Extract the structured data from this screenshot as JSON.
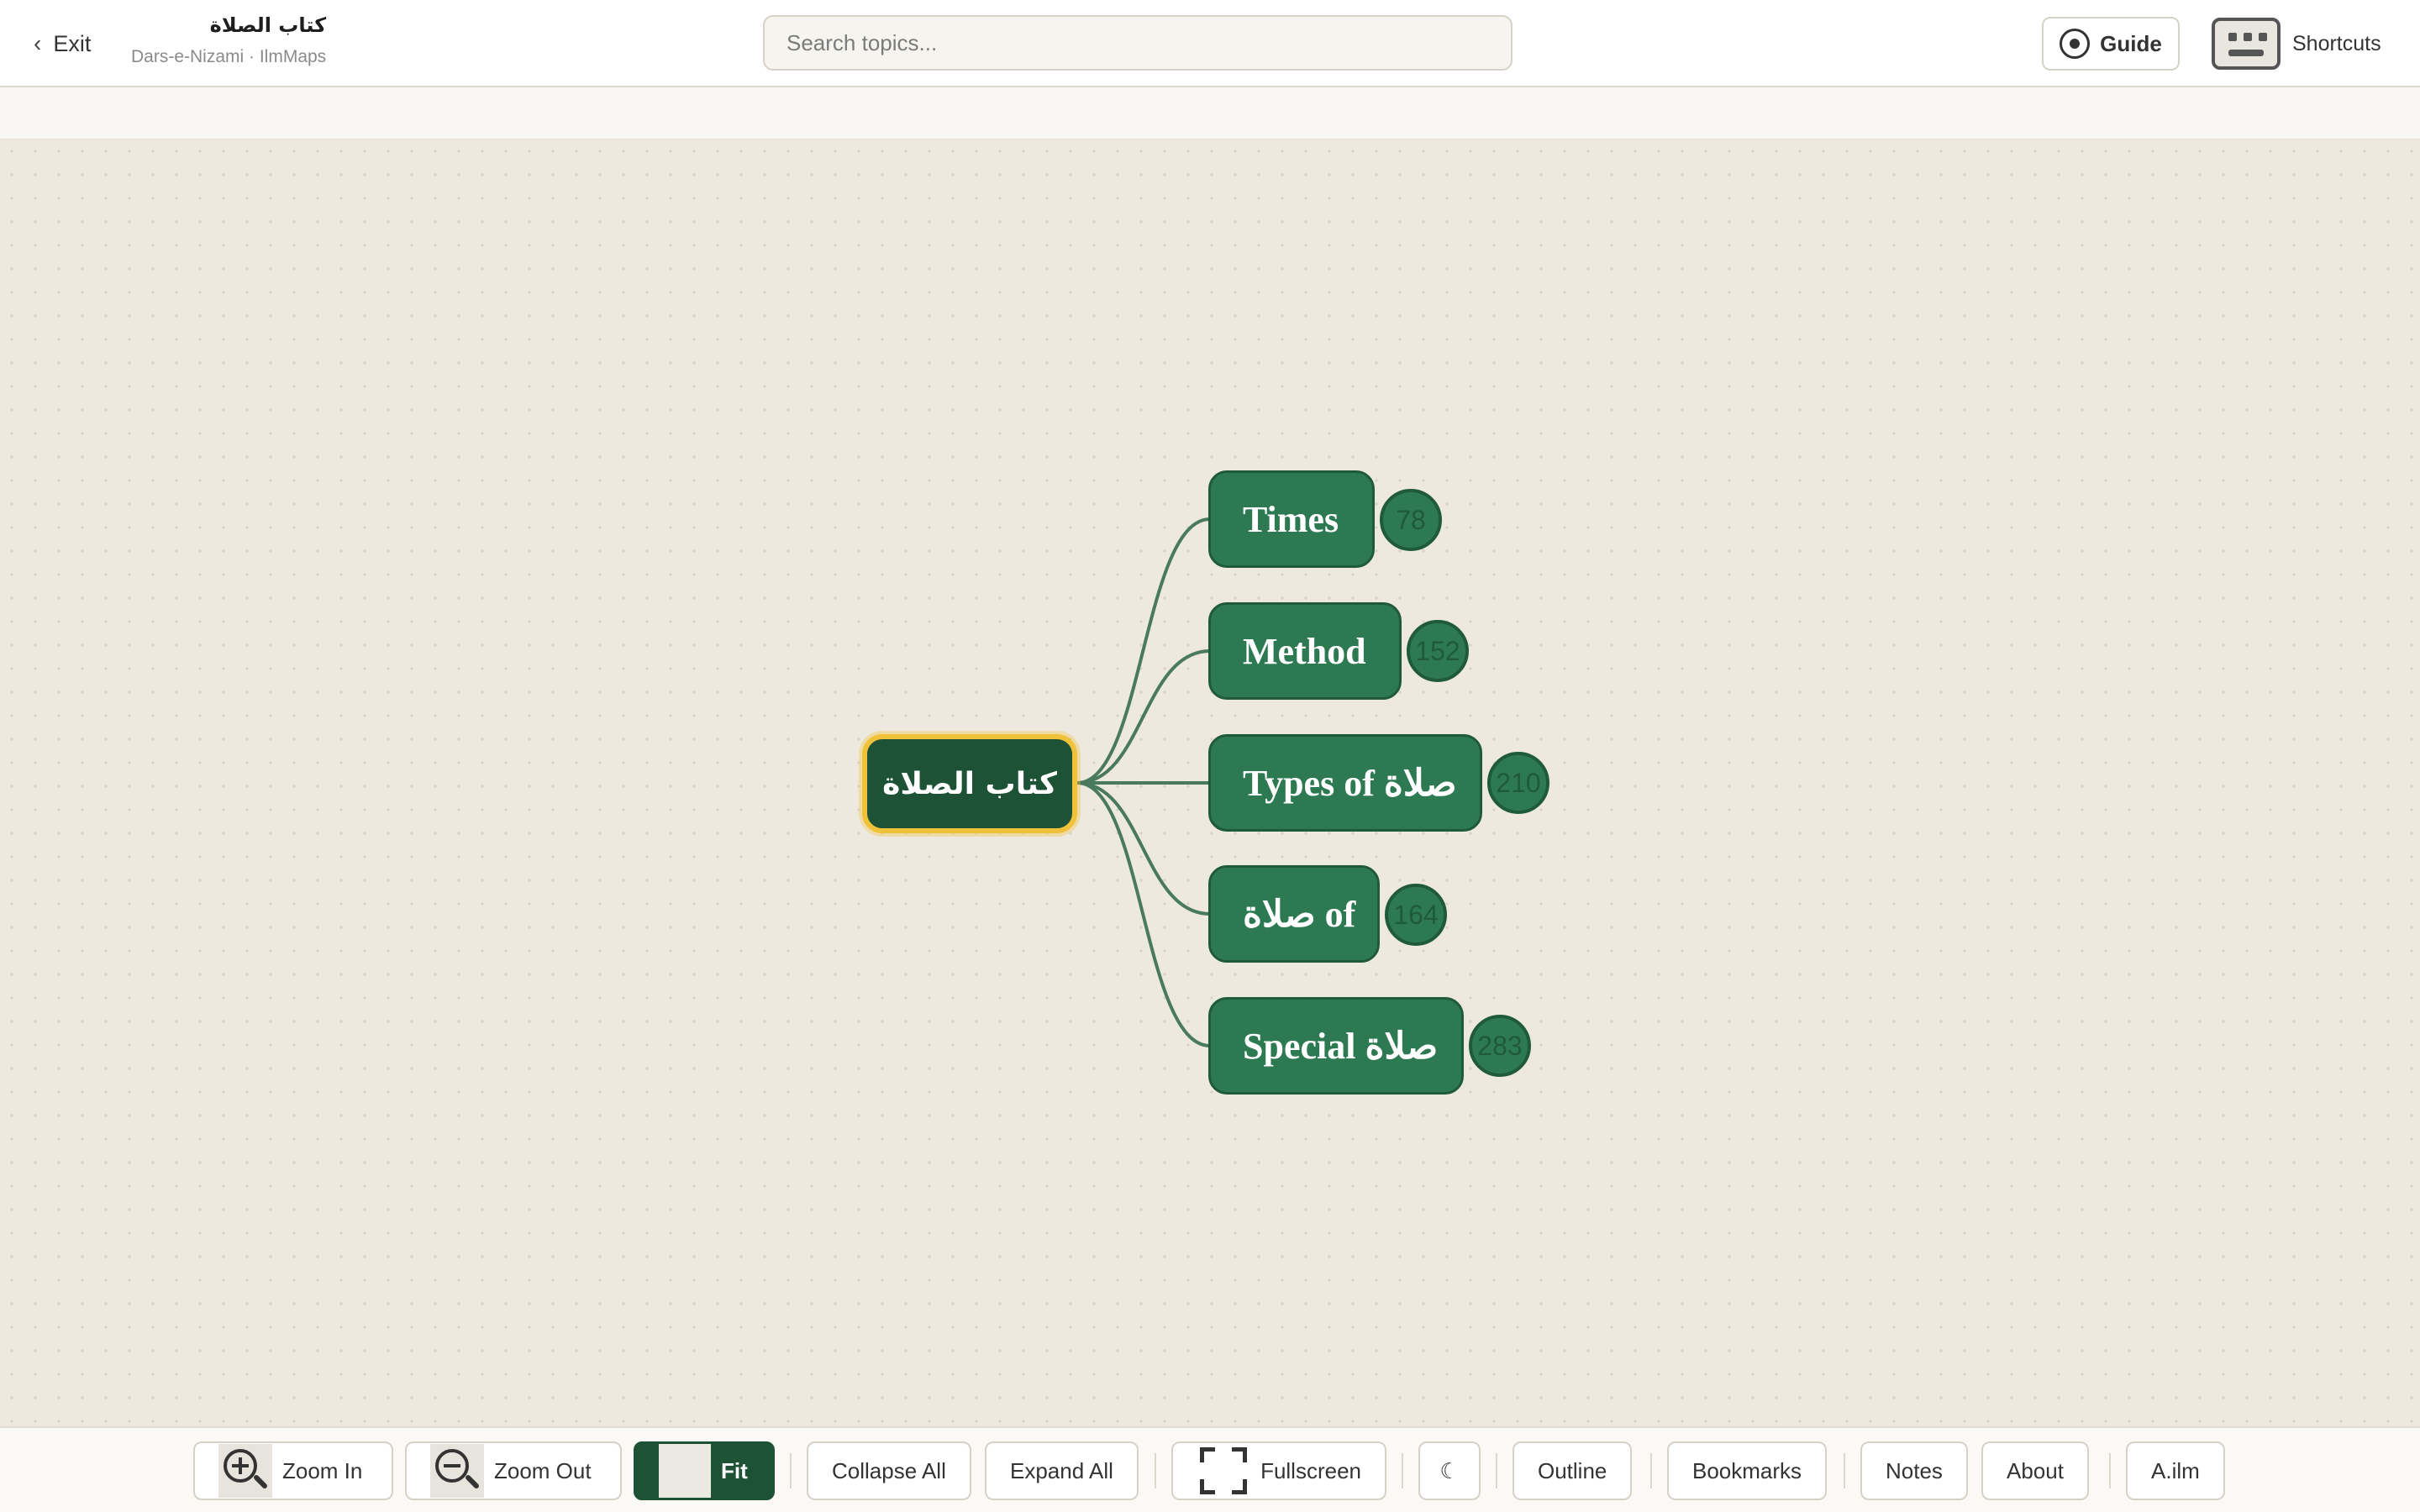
{
  "header": {
    "exit_label": "Exit",
    "title": "كتاب الصلاة",
    "subtitle": "Dars-e-Nizami · IlmMaps",
    "search_placeholder": "Search topics...",
    "guide_label": "Guide",
    "shortcuts_label": "Shortcuts"
  },
  "mindmap": {
    "root": {
      "label": "كتاب الصلاة"
    },
    "children": [
      {
        "label": "Times",
        "count": "78"
      },
      {
        "label": "Method",
        "count": "152"
      },
      {
        "label": "Types of صلاة",
        "count": "210"
      },
      {
        "label": "صلاة of",
        "count": "164"
      },
      {
        "label": "Special صلاة",
        "count": "283"
      }
    ]
  },
  "toolbar": {
    "zoom_in": "Zoom In",
    "zoom_out": "Zoom Out",
    "fit": "Fit",
    "collapse_all": "Collapse All",
    "expand_all": "Expand All",
    "fullscreen": "Fullscreen",
    "theme_toggle": "☾",
    "outline": "Outline",
    "bookmarks": "Bookmarks",
    "notes": "Notes",
    "about": "About",
    "brand": "A.ilm"
  },
  "colors": {
    "node_fill": "#2d7a52",
    "root_fill": "#1d5236",
    "root_border": "#f0c23a",
    "edge": "#4a7a5c",
    "canvas_bg": "#ede9df"
  }
}
